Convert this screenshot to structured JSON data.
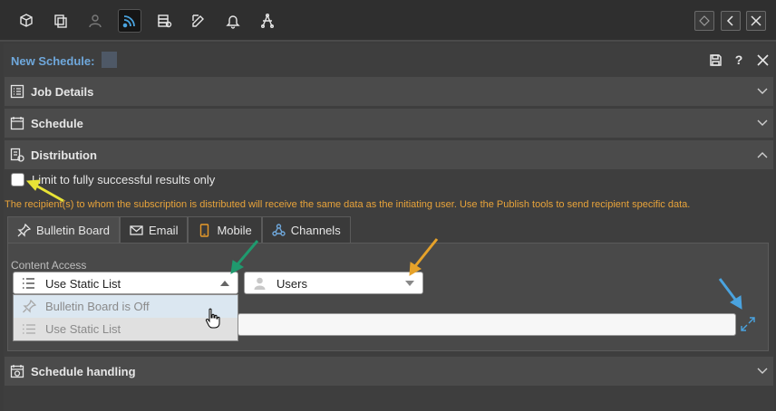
{
  "toolbar": {
    "icons": [
      "cube-icon",
      "copy-icon",
      "user-icon",
      "rss-icon",
      "database-icon",
      "pencil-icon",
      "bell-icon",
      "network-icon"
    ],
    "active": "rss-icon",
    "right_buttons": [
      "diamond-icon",
      "chevron-left-icon",
      "close-icon"
    ]
  },
  "panel": {
    "title": "New Schedule:",
    "title_actions": {
      "save": "save-icon",
      "help": "?",
      "close": "close-icon"
    }
  },
  "sections": {
    "job_details": "Job Details",
    "schedule": "Schedule",
    "distribution": "Distribution",
    "schedule_handling": "Schedule handling"
  },
  "distribution": {
    "limit_label": "Limit to fully successful results only",
    "limit_checked": false,
    "note": "The recipient(s) to whom the subscription is distributed will receive the same data as the initiating user. Use the Publish tools to send recipient specific data.",
    "tabs": [
      {
        "label": "Bulletin Board",
        "icon": "pin-icon"
      },
      {
        "label": "Email",
        "icon": "envelope-icon"
      },
      {
        "label": "Mobile",
        "icon": "mobile-icon"
      },
      {
        "label": "Channels",
        "icon": "channels-icon"
      }
    ],
    "active_tab": "Bulletin Board",
    "content_access_label": "Content Access",
    "access_select": "Use Static List",
    "access_options": [
      "Bulletin Board is Off",
      "Use Static List"
    ],
    "users_select": "Users",
    "list_value": ""
  },
  "colors": {
    "accent": "#6fa8dc",
    "note": "#e8a33a",
    "arrow_yellow": "#e8e336",
    "arrow_green": "#1f9a6e",
    "arrow_orange": "#e6a22a",
    "arrow_blue": "#4aa3df"
  }
}
